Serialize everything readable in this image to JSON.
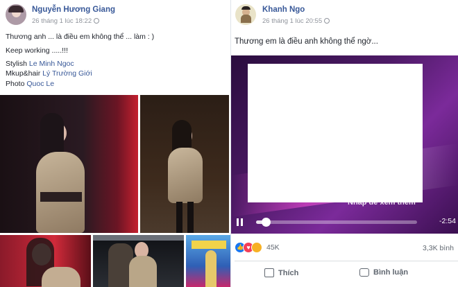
{
  "left_post": {
    "author": "Nguyễn Hương Giang",
    "timestamp": "26 tháng 1 lúc 18:22",
    "caption": "Thương anh ... là điều em không thể ... làm : )",
    "line2": "Keep working .....!!!",
    "stylish_label": "Stylish",
    "stylish_name": "Le Minh Ngoc",
    "mkup_label": "Mkup&hair",
    "mkup_name": "Lý Trường Giới",
    "photo_label": "Photo",
    "photo_name": "Quoc Le"
  },
  "right_post": {
    "author": "Khanh Ngo",
    "timestamp": "26 tháng 1 lúc 20:55",
    "caption": "Thương em là điều anh không thể ngờ...",
    "video_overlay_text": "Nhấp để xem thêm",
    "video_time": "-2:54",
    "video_progress": 0.06,
    "reactions_count": "45K",
    "comments_count": "3,3K bình",
    "like_label": "Thích",
    "comment_label": "Bình luận"
  },
  "colors": {
    "link": "#385898",
    "like_blue": "#1877f2",
    "heart_red": "#f33e58",
    "haha_yellow": "#f7b125"
  },
  "icons": [
    "globe-icon",
    "like-reaction-icon",
    "love-reaction-icon",
    "haha-reaction-icon",
    "pause-icon",
    "like-icon",
    "comment-icon"
  ]
}
